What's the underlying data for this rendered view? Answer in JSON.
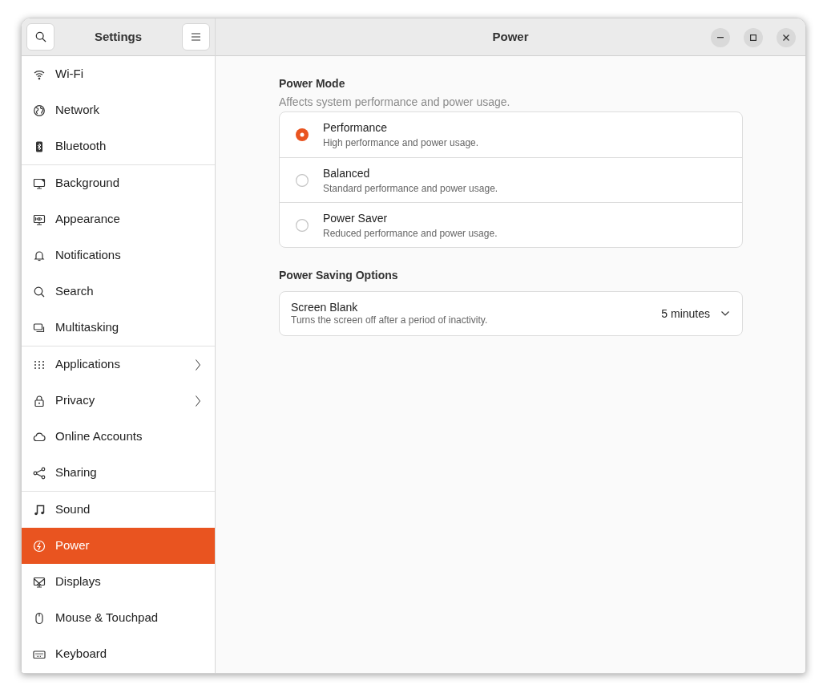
{
  "window": {
    "title": "Power",
    "sidebar_title": "Settings"
  },
  "sidebar": {
    "groups": [
      {
        "items": [
          {
            "label": "Wi-Fi",
            "selected": false,
            "submenu": false
          },
          {
            "label": "Network",
            "selected": false,
            "submenu": false
          },
          {
            "label": "Bluetooth",
            "selected": false,
            "submenu": false
          }
        ]
      },
      {
        "items": [
          {
            "label": "Background",
            "selected": false,
            "submenu": false
          },
          {
            "label": "Appearance",
            "selected": false,
            "submenu": false
          },
          {
            "label": "Notifications",
            "selected": false,
            "submenu": false
          },
          {
            "label": "Search",
            "selected": false,
            "submenu": false
          },
          {
            "label": "Multitasking",
            "selected": false,
            "submenu": false
          }
        ]
      },
      {
        "items": [
          {
            "label": "Applications",
            "selected": false,
            "submenu": true
          },
          {
            "label": "Privacy",
            "selected": false,
            "submenu": true
          },
          {
            "label": "Online Accounts",
            "selected": false,
            "submenu": false
          },
          {
            "label": "Sharing",
            "selected": false,
            "submenu": false
          }
        ]
      },
      {
        "items": [
          {
            "label": "Sound",
            "selected": false,
            "submenu": false
          },
          {
            "label": "Power",
            "selected": true,
            "submenu": false
          },
          {
            "label": "Displays",
            "selected": false,
            "submenu": false
          },
          {
            "label": "Mouse & Touchpad",
            "selected": false,
            "submenu": false
          },
          {
            "label": "Keyboard",
            "selected": false,
            "submenu": false
          }
        ]
      }
    ]
  },
  "power_mode": {
    "title": "Power Mode",
    "subtitle": "Affects system performance and power usage.",
    "options": [
      {
        "label": "Performance",
        "description": "High performance and power usage.",
        "selected": true
      },
      {
        "label": "Balanced",
        "description": "Standard performance and power usage.",
        "selected": false
      },
      {
        "label": "Power Saver",
        "description": "Reduced performance and power usage.",
        "selected": false
      }
    ]
  },
  "power_saving": {
    "title": "Power Saving Options",
    "rows": [
      {
        "label": "Screen Blank",
        "description": "Turns the screen off after a period of inactivity.",
        "value": "5 minutes"
      }
    ]
  }
}
